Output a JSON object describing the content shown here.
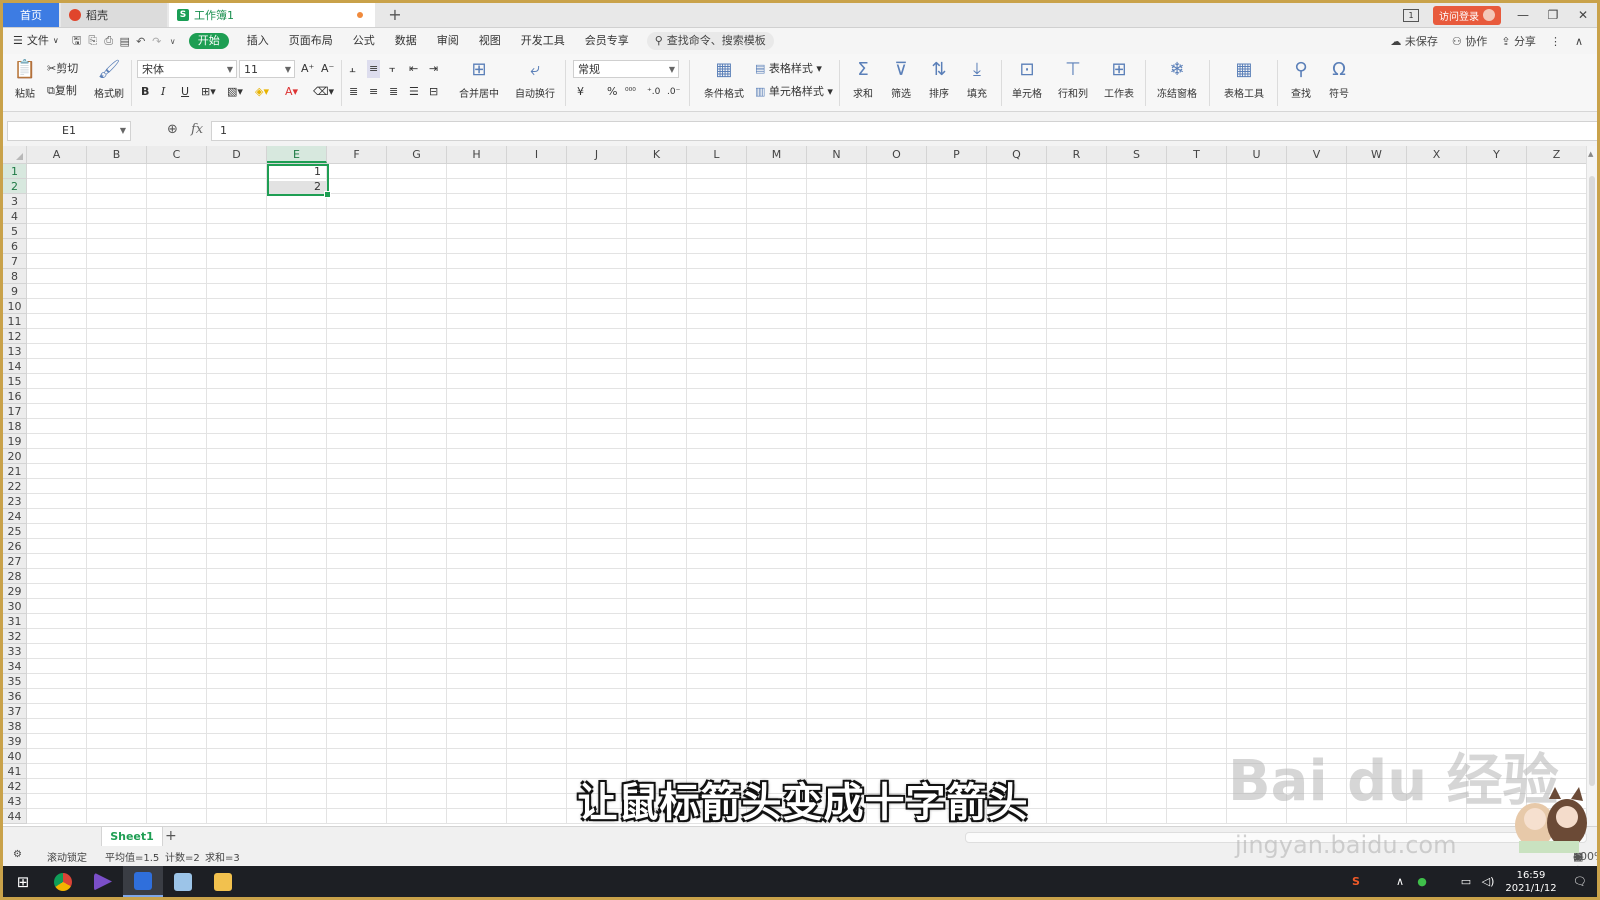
{
  "titlebar": {
    "tabs": [
      {
        "label": "首页"
      },
      {
        "label": "稻壳"
      },
      {
        "label": "工作簿1"
      }
    ],
    "new_tab": "+",
    "login_label": "访问登录"
  },
  "menubar": {
    "file_label": "文件",
    "items": [
      "开始",
      "插入",
      "页面布局",
      "公式",
      "数据",
      "审阅",
      "视图",
      "开发工具",
      "会员专享"
    ],
    "search_placeholder": "查找命令、搜索模板",
    "right": {
      "unsaved": "未保存",
      "collab": "协作",
      "share": "分享"
    }
  },
  "ribbon": {
    "paste": "粘贴",
    "cut": "剪切",
    "copy": "复制",
    "format_painter": "格式刷",
    "font_name": "宋体",
    "font_size": "11",
    "merge_center": "合并居中",
    "wrap_text": "自动换行",
    "number_format": "常规",
    "conditional_format": "条件格式",
    "table_style": "表格样式",
    "cell_style": "单元格样式",
    "sum": "求和",
    "filter": "筛选",
    "sort": "排序",
    "fill": "填充",
    "cells": "单元格",
    "rows_cols": "行和列",
    "worksheet": "工作表",
    "freeze": "冻结窗格",
    "table_tools": "表格工具",
    "find": "查找",
    "symbol": "符号",
    "bold": "B",
    "italic": "I",
    "underline": "U",
    "currency": "¥",
    "percent": "%"
  },
  "formula_bar": {
    "name_box": "E1",
    "fx": "fx",
    "value": "1"
  },
  "grid": {
    "columns": [
      "A",
      "B",
      "C",
      "D",
      "E",
      "F",
      "G",
      "H",
      "I",
      "J",
      "K",
      "L",
      "M",
      "N",
      "O",
      "P",
      "Q",
      "R",
      "S",
      "T",
      "U",
      "V",
      "W",
      "X",
      "Y",
      "Z"
    ],
    "selected_column": "E",
    "row_count": 44,
    "selected_rows": [
      1,
      2
    ],
    "cells": {
      "E1": "1",
      "E2": "2"
    }
  },
  "sheets": {
    "tabs": [
      "Sheet1"
    ],
    "add": "+"
  },
  "statusbar": {
    "scroll_lock": "滚动锁定",
    "average": "平均值=1.5",
    "count": "计数=2",
    "sum": "求和=3",
    "zoom": "100%"
  },
  "overlay": {
    "subtitle": "让鼠标箭头变成十字箭头",
    "watermark": "Bai du 经验",
    "watermark_url": "jingyan.baidu.com"
  },
  "taskbar": {
    "time": "16:59",
    "date": "2021/1/12"
  },
  "colors": {
    "accent_green": "#1e9e53",
    "home_tab_blue": "#3d7ce3",
    "login_red": "#e85a3c"
  }
}
